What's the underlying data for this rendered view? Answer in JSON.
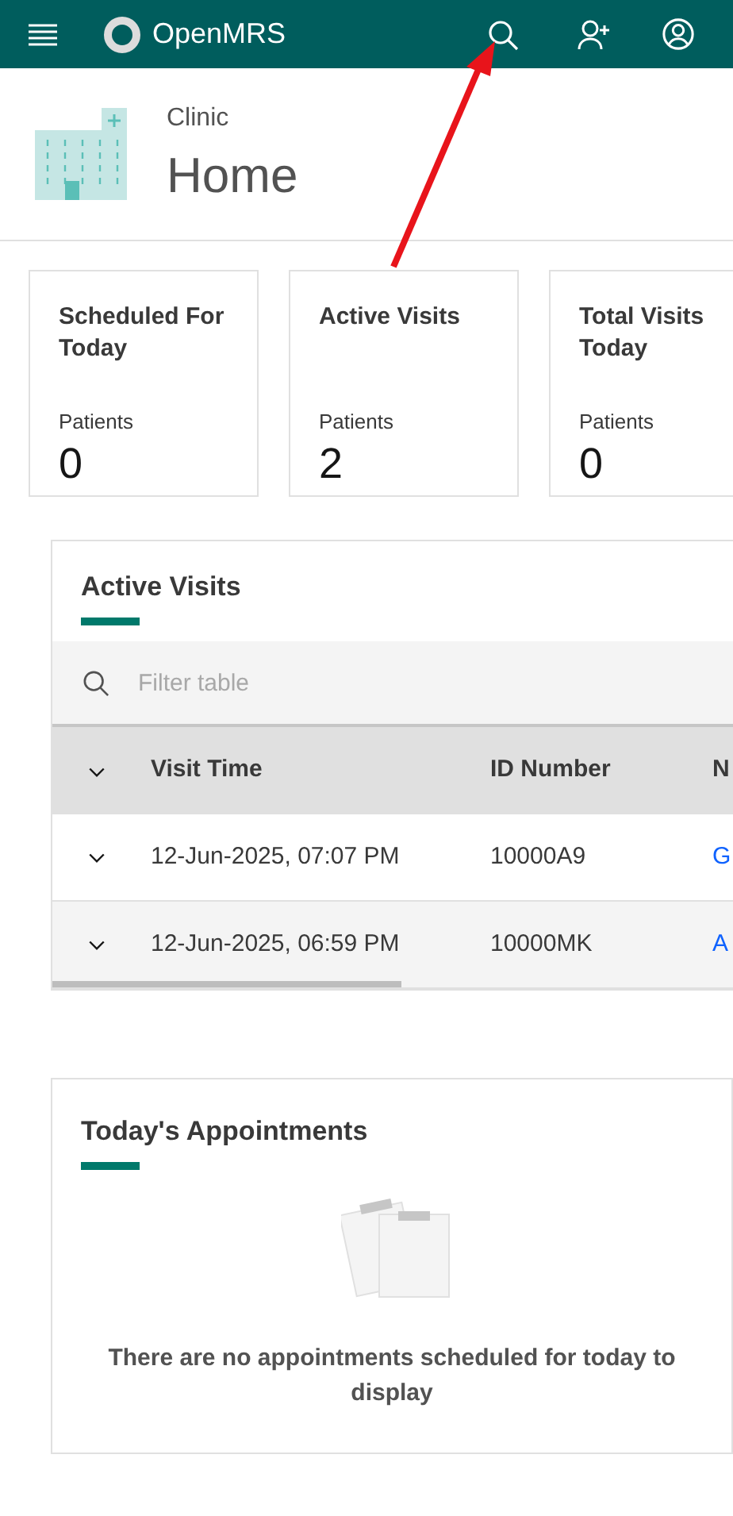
{
  "header": {
    "brand": "OpenMRS"
  },
  "page": {
    "location": "Clinic",
    "title": "Home"
  },
  "metrics": [
    {
      "title": "Scheduled For Today",
      "label": "Patients",
      "value": "0"
    },
    {
      "title": "Active Visits",
      "label": "Patients",
      "value": "2"
    },
    {
      "title": "Total Visits Today",
      "label": "Patients",
      "value": "0"
    }
  ],
  "active_visits": {
    "title": "Active Visits",
    "filter": {
      "placeholder": "Filter table"
    },
    "columns": [
      "Visit Time",
      "ID Number",
      "N"
    ],
    "rows": [
      {
        "visit_time": "12-Jun-2025, 07:07 PM",
        "id_number": "10000A9",
        "name": "G"
      },
      {
        "visit_time": "12-Jun-2025, 06:59 PM",
        "id_number": "10000MK",
        "name": "A"
      }
    ]
  },
  "appointments": {
    "title": "Today's Appointments",
    "empty_message": "There are no appointments scheduled for today to display"
  }
}
